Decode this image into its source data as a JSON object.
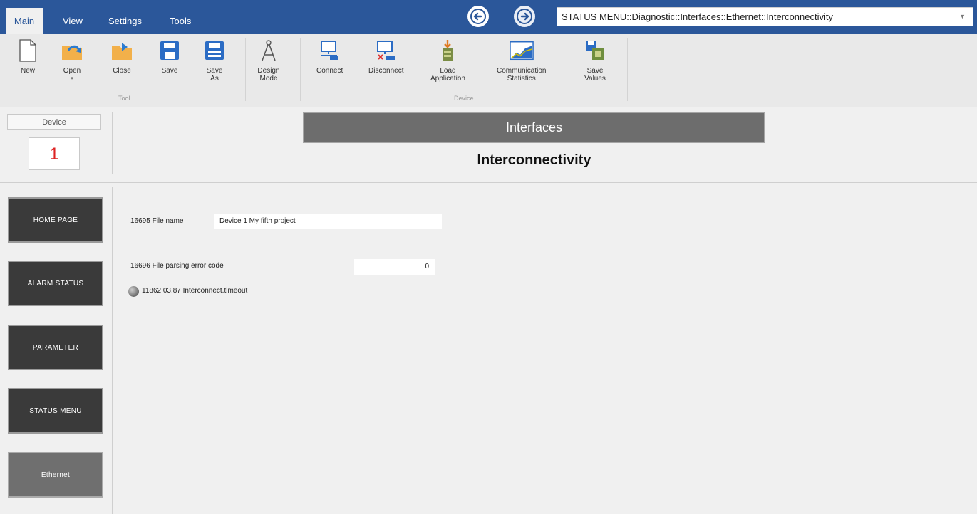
{
  "menu": {
    "tabs": [
      "Main",
      "View",
      "Settings",
      "Tools"
    ]
  },
  "path": "STATUS MENU::Diagnostic::Interfaces::Ethernet::Interconnectivity",
  "ribbon": {
    "new": "New",
    "open": "Open",
    "close": "Close",
    "save": "Save",
    "save_as": "Save\nAs",
    "design_mode": "Design\nMode",
    "connect": "Connect",
    "disconnect": "Disconnect",
    "load_application": "Load\nApplication",
    "communication_statistics": "Communication\nStatistics",
    "save_values": "Save\nValues",
    "group_tool": "Tool",
    "group_device": "Device"
  },
  "device": {
    "label": "Device",
    "number": "1"
  },
  "sidebar": {
    "items": [
      "HOME PAGE",
      "ALARM STATUS",
      "PARAMETER",
      "STATUS MENU",
      "Ethernet"
    ]
  },
  "main": {
    "header": "Interfaces",
    "title": "Interconnectivity",
    "file_name_label": "16695 File name",
    "file_name_value": "Device 1 My fifth project",
    "parse_error_label": "16696 File parsing error code",
    "parse_error_value": "0",
    "timeout_label": "11862 03.87 Interconnect.timeout"
  },
  "colors": {
    "menubar": "#2b579a",
    "device_number": "#dd2222",
    "button_dark": "#3a3a3a",
    "button_selected": "#6f6f6f"
  }
}
